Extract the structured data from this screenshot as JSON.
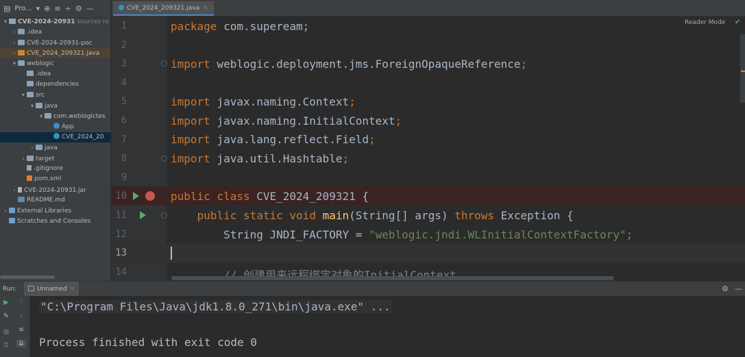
{
  "project": {
    "toolbar_label": "Pro...",
    "tree": [
      {
        "depth": 0,
        "arrow": "▾",
        "icon": "folder",
        "label": "CVE-2024-20931",
        "suffix": " sources ro",
        "bold": true
      },
      {
        "depth": 1,
        "arrow": "›",
        "icon": "folder",
        "label": ".idea"
      },
      {
        "depth": 1,
        "arrow": "›",
        "icon": "folder",
        "label": "CVE-2024-20931-poc"
      },
      {
        "depth": 1,
        "arrow": "›",
        "icon": "folder-o",
        "label": "CVE_2024_209321.java",
        "state": "hl"
      },
      {
        "depth": 1,
        "arrow": "▾",
        "icon": "folder",
        "label": "weblogic"
      },
      {
        "depth": 2,
        "arrow": "",
        "icon": "folder",
        "label": ".idea"
      },
      {
        "depth": 2,
        "arrow": "",
        "icon": "folder",
        "label": "dependencies"
      },
      {
        "depth": 2,
        "arrow": "▾",
        "icon": "folder",
        "label": "src"
      },
      {
        "depth": 3,
        "arrow": "▾",
        "icon": "folder",
        "label": "java"
      },
      {
        "depth": 4,
        "arrow": "▾",
        "icon": "folder",
        "label": "com.weblogictes"
      },
      {
        "depth": 5,
        "arrow": "",
        "icon": "java",
        "label": "App"
      },
      {
        "depth": 5,
        "arrow": "",
        "icon": "java",
        "label": "CVE_2024_20",
        "state": "sel"
      },
      {
        "depth": 3,
        "arrow": "›",
        "icon": "folder",
        "label": "java"
      },
      {
        "depth": 2,
        "arrow": "›",
        "icon": "folder",
        "label": "target"
      },
      {
        "depth": 2,
        "arrow": "",
        "icon": "file",
        "label": ".gitignore"
      },
      {
        "depth": 2,
        "arrow": "",
        "icon": "xml",
        "label": "pom.xml"
      },
      {
        "depth": 1,
        "arrow": "›",
        "icon": "jar",
        "label": "CVE-2024-20931.jar"
      },
      {
        "depth": 1,
        "arrow": "",
        "icon": "md",
        "label": "README.md"
      },
      {
        "depth": 0,
        "arrow": "›",
        "icon": "lib",
        "label": "External Libraries"
      },
      {
        "depth": 0,
        "arrow": "",
        "icon": "lib",
        "label": "Scratches and Consoles"
      }
    ]
  },
  "editor": {
    "tab_label": "CVE_2024_209321.java",
    "reader_mode": "Reader Mode",
    "line_numbers": [
      "1",
      "2",
      "3",
      "4",
      "5",
      "6",
      "7",
      "8",
      "9",
      "10",
      "11",
      "12",
      "13",
      "14"
    ],
    "current_line": "13",
    "code": {
      "l1_kw": "package",
      "l1_rest": " com.supeream;",
      "l3_kw": "import",
      "l3_rest": " weblogic.deployment.jms.ForeignOpaqueReference",
      "l5_kw": "import",
      "l5_rest": " javax.naming.Context",
      "l6_kw": "import",
      "l6_rest": " javax.naming.InitialContext",
      "l7_kw": "import",
      "l7_rest": " java.lang.reflect.Field",
      "l8_kw": "import",
      "l8_rest": " java.util.Hashtable",
      "semicolon": ";",
      "l10_kw": "public class",
      "l10_rest": " CVE_2024_209321 {",
      "l11_indent": "    ",
      "l11_kw": "public static void",
      "l11_fn": "main",
      "l11_mid": "(String[] args) ",
      "l11_kw2": "throws",
      "l11_rest": " Exception {",
      "l12_indent": "        ",
      "l12_rest": "String JNDI_FACTORY = ",
      "l12_str": "\"weblogic.jndi.WLInitialContextFactory\"",
      "l14_indent": "        ",
      "l14_comment": "// 创建用来远程绑定对象的InitialContext"
    }
  },
  "run": {
    "label": "Run:",
    "tab_label": "Unnamed",
    "console_cmd": "\"C:\\Program Files\\Java\\jdk1.8.0_271\\bin\\java.exe\" ...",
    "console_exit": "Process finished with exit code 0"
  },
  "icons": {
    "project-menu": "▾",
    "target-icon": "⊕",
    "expand-all-icon": "≡",
    "collapse-all-icon": "÷",
    "settings-icon": "⚙",
    "minimize-icon": "—",
    "check-icon": "✔",
    "run-icon": "▶",
    "breakpoint-icon": "●"
  },
  "colors": {
    "breakpoint": "#c75450",
    "run_gutter": "#59a869",
    "keyword": "#cc7832",
    "string": "#6a8759",
    "function": "#ffc66d",
    "comment": "#808080"
  }
}
